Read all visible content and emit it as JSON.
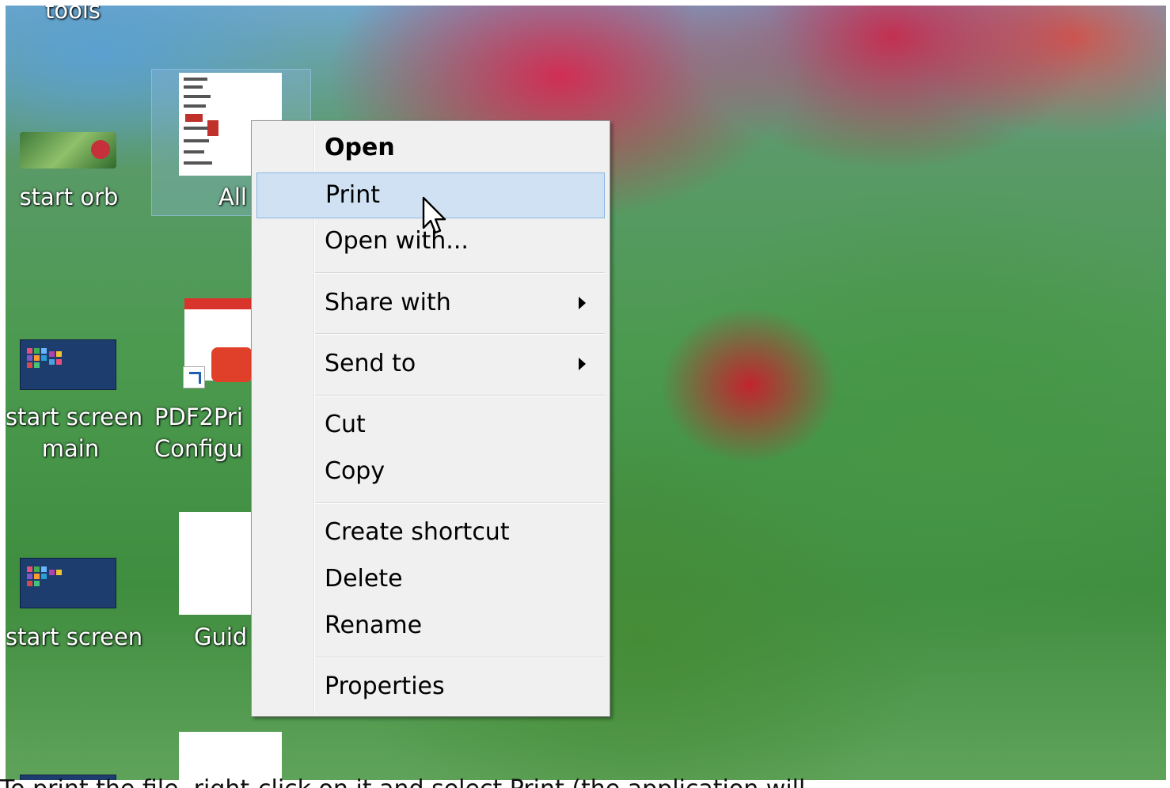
{
  "desktop": {
    "icons": [
      {
        "label": "tools"
      },
      {
        "label": "start orb"
      },
      {
        "label": "All"
      },
      {
        "label_line1": "start screen",
        "label_line2": "main"
      },
      {
        "label_line1": "PDF2Pri",
        "label_line2": "Configu"
      },
      {
        "label": "start screen"
      },
      {
        "label": "Guid"
      }
    ]
  },
  "context_menu": {
    "items": [
      {
        "label": "Open",
        "bold": true
      },
      {
        "label": "Print",
        "highlighted": true
      },
      {
        "label": "Open with..."
      },
      {
        "label": "Share with",
        "submenu": true
      },
      {
        "label": "Send to",
        "submenu": true
      },
      {
        "label": "Cut"
      },
      {
        "label": "Copy"
      },
      {
        "label": "Create shortcut"
      },
      {
        "label": "Delete"
      },
      {
        "label": "Rename"
      },
      {
        "label": "Properties"
      }
    ]
  },
  "caption": {
    "text": "To print the file, right-click on it and select Print (the application will"
  },
  "colors": {
    "menu_background": "#f0f0f0",
    "menu_highlight": "#cfe1f3",
    "menu_highlight_border": "#8bb5df"
  }
}
